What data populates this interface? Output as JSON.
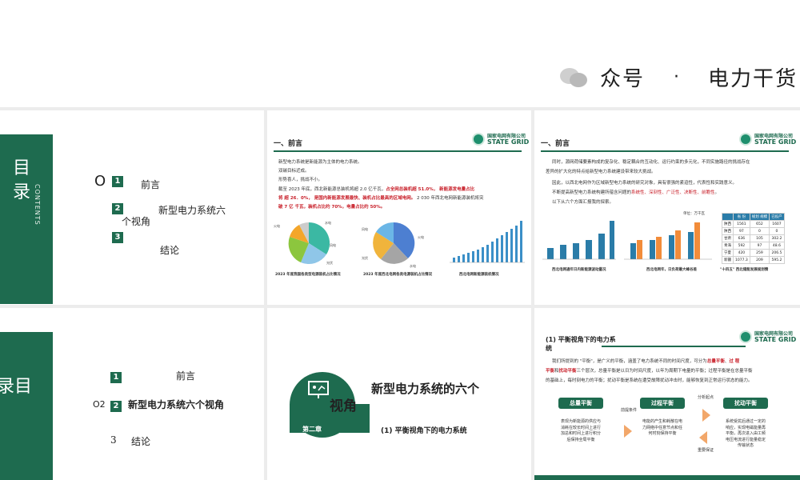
{
  "watermark": {
    "left": "众号",
    "dot": "·",
    "right": "电力干货"
  },
  "logo": {
    "cn": "国家电网有限公司",
    "en": "STATE GRID",
    "sub": "CORPORATION OF CHINA"
  },
  "slide1": {
    "title_chars": [
      "目",
      "录"
    ],
    "contents": "CONTENTS",
    "items": [
      {
        "num": "1",
        "label": "前言"
      },
      {
        "num": "2",
        "label_a": "新型电力系统六",
        "label_b": "个视角"
      },
      {
        "num": "3",
        "label": "结论"
      }
    ],
    "marker": "O"
  },
  "slide2": {
    "heading": "一、前言",
    "lines": {
      "l1": "新型电力系统是新能源为主体的电力系统。",
      "l2": "双碳目标近成。",
      "l3": "形势喜人，挑战不小。",
      "l4a": "截至 2023 年底，西北新能源总装机将超 2.0 亿千瓦，",
      "l4b": "占全网总装机超 51.0%，",
      "l4c": " 新能源发电量占比",
      "l5a": "将 超 26．0%，",
      "l5b": " 是国内新能源发展最快、装机占比最高的区域电网。",
      "l5c": " 2 030 年西北电网新能源装机将突",
      "l6": "破 7 亿 千瓦，装机占比约 70%，电量占比约 50%。"
    },
    "captions": {
      "c1": "2023 年底我国各类型电源装机占比情况",
      "c2": "2023 年底西北电网各类电源装机占比情况",
      "c3": "西北电网新能源装机情况"
    },
    "pie1_labels": [
      "火电",
      "水电",
      "风电",
      "光伏",
      "核电",
      "其他"
    ],
    "pie2_labels": [
      "火电",
      "风电",
      "光伏",
      "水电"
    ],
    "bar3_x": [
      "2015",
      "2016",
      "2017",
      "2018",
      "2019",
      "2020",
      "2021",
      "2022",
      "2023",
      "2024",
      "2025",
      "2026",
      "2027",
      "2028",
      "2029",
      "2030"
    ]
  },
  "slide3": {
    "heading": "一、前言",
    "lines": {
      "l1": "同时，源网荷储要素构成的复杂化、稳定耦合的互动化、运行约束的多元化，不同实施路径的挑战存在",
      "l2": "差异的扩大化的特点给新型电力系统建设带来较大挑战。",
      "l3": "因此，以西北电网作为区域新型电力系统的研究对象，具有很强的紧迫性，代表性和实践意义。",
      "l4a": "不断提高新型电力系统构建所蕴含问题的",
      "l4b": "系统性、深刻性、广泛性、决断性、前瞻性",
      "l4c": "。",
      "l5": "以下从六个方面汇报我的探索。"
    },
    "unit": "单位：万千瓦",
    "captions": {
      "c1": "西北电网通年日内新能源波动量况",
      "c2": "西北电网年，日负荷最大峰谷差",
      "c3": "\"十四五\" 西北储能发展规划情"
    },
    "table": {
      "headers": [
        "省 份",
        "规划 规模",
        "已投产"
      ],
      "rows": [
        [
          "陕西",
          "1561",
          "652",
          "1607"
        ],
        [
          "陕西",
          "97",
          "0",
          "0"
        ],
        [
          "甘肃",
          "636",
          "105",
          "302.2"
        ],
        [
          "青海",
          "592",
          "97",
          "48.6"
        ],
        [
          "宁夏",
          "420",
          "259",
          "206.5"
        ],
        [
          "新疆",
          "1077.3",
          "209",
          "595.2"
        ]
      ]
    }
  },
  "slide4": {
    "title_chars": "录目",
    "items": [
      {
        "num": "1",
        "label": "前言"
      },
      {
        "num": "2",
        "prefix": "O2",
        "label": "新型电力系统六个视角"
      },
      {
        "num": "3",
        "label": "结论"
      }
    ]
  },
  "slide5": {
    "title_a": "新型电力系统的六个",
    "title_b": "视角",
    "chapter": "第二章",
    "sub": "(1) 平衡视角下的电力系统"
  },
  "slide6": {
    "heading_a": "(1) 平衡视角下的电力系",
    "heading_b": "统",
    "lines": {
      "l1a": "我们所提到的 \"平衡\"，是广义的平衡，涵盖了电力系统不同的时间尺度，可分为",
      "l1b": "总量平衡",
      "l1c": "、",
      "l1d": "过 程",
      "l2a": "平衡",
      "l2b": "和",
      "l2c": "扰动平衡",
      "l2d": "三个层次，总量平衡是以日为时间尺度，以年为周期下电量的平衡；过程平衡是在总量平衡",
      "l3": "的基础上，每时刻电力的平衡；扰动平衡是系统在遭受故障扰动冲击时，能够恢复到正常运行状态的能力。"
    },
    "boxes": [
      {
        "head": "总量平衡",
        "body": "表现为新能源的供应与消耗在较长时间上进行加总和时间上进行积分后保持全局平衡"
      },
      {
        "head": "过程平衡",
        "body": "电能的产生和耗散在电力网络中任意节点和任何时刻保持平衡"
      },
      {
        "head": "扰动平衡",
        "body": "系统受扰后通过一定的响应，实现电磁能量再平衡，再次进入由工频电压电流进行能量稳定传输状态"
      }
    ],
    "labels": {
      "pre": "前提条件",
      "split": "分析起点",
      "guarantee": "重要保证"
    }
  },
  "colors": {
    "brand_green": "#1e6b4f",
    "accent_red": "#c8202a",
    "arrow_orange": "#f2a76a",
    "table_blue": "#2a7ca8"
  }
}
